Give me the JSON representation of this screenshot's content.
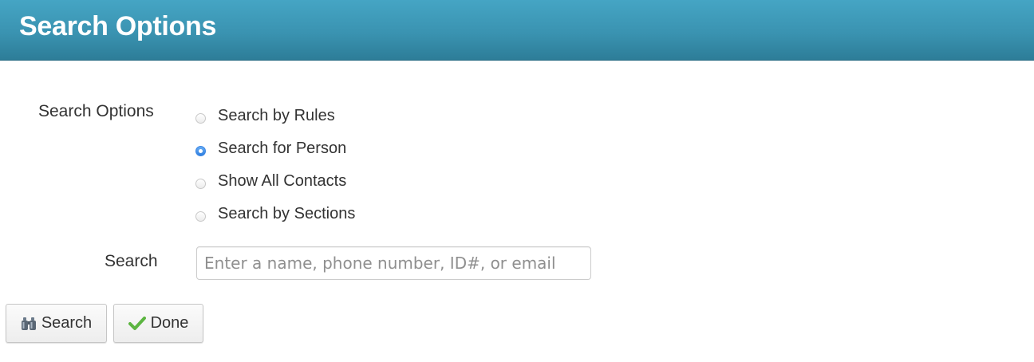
{
  "header": {
    "title": "Search Options"
  },
  "form": {
    "options_label": "Search Options",
    "options": [
      {
        "label": "Search by Rules",
        "checked": false
      },
      {
        "label": "Search for Person",
        "checked": true
      },
      {
        "label": "Show All Contacts",
        "checked": false
      },
      {
        "label": "Search by Sections",
        "checked": false
      }
    ],
    "search_label": "Search",
    "search_placeholder": "Enter a name, phone number, ID#, or email",
    "search_value": ""
  },
  "buttons": {
    "search_label": "Search",
    "search_icon": "binoculars-icon",
    "done_label": "Done",
    "done_icon": "checkmark-icon"
  },
  "colors": {
    "header_top": "#45a5c4",
    "header_bottom": "#2d7d98",
    "radio_selected": "#2f7fe0",
    "check_green": "#5cb541"
  }
}
